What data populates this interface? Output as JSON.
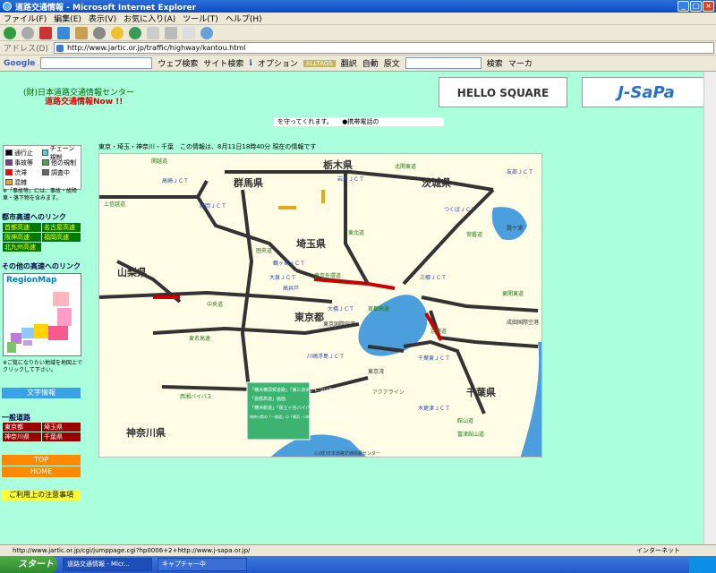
{
  "window": {
    "title": "道路交通情報 - Microsoft Internet Explorer"
  },
  "menu": [
    "ファイル(F)",
    "編集(E)",
    "表示(V)",
    "お気に入り(A)",
    "ツール(T)",
    "ヘルプ(H)"
  ],
  "address": {
    "label": "アドレス(D)",
    "url": "http://www.jartic.or.jp/traffic/highway/kantou.html"
  },
  "googlebar": {
    "brand": "Google",
    "web_search": "ウェブ検索",
    "site_search": "サイト検索",
    "options": "オプション",
    "translate": "翻訳",
    "auto": "自動",
    "original": "原文",
    "search": "検索",
    "marker": "マーカ"
  },
  "header": {
    "org": "(財)日本道路交通情報センター",
    "product": "道路交通情報Now !!",
    "banner1": "HELLO SQUARE",
    "banner2": "J-SaPa",
    "ticker": "を守ってくれます。　　●携帯電話の"
  },
  "legend": {
    "items": [
      [
        "通行止",
        "チェーン規制"
      ],
      [
        "事故等",
        "他の規制"
      ],
      [
        "渋滞",
        "調査中"
      ],
      [
        "混雑",
        ""
      ]
    ],
    "note": "※「事故等」には、事故・故障車・落下物を含みます。"
  },
  "urban": {
    "heading": "都市高速へのリンク",
    "links": [
      "首都高速",
      "名古屋高速",
      "阪神高速",
      "福岡高速",
      "北九州高速"
    ]
  },
  "other": {
    "heading": "その他の高速へのリンク",
    "region_title": "RegionMap",
    "note": "※ご覧になりたい地域を地図上でクリックして下さい。"
  },
  "buttons": {
    "text_info": "文字情報",
    "top": "TOP",
    "home": "HOME",
    "notice": "ご利用上の注意事項"
  },
  "general": {
    "heading": "一般道路",
    "links": [
      "東京都",
      "埼玉県",
      "神奈川県",
      "千葉県"
    ]
  },
  "map": {
    "caption": "東京・埼玉・神奈川・千葉　この情報は、8月11日18時40分 現在の情報です",
    "prefectures": [
      "栃木県",
      "群馬県",
      "茨城県",
      "埼玉県",
      "山梨県",
      "東京都",
      "千葉県",
      "神奈川県"
    ],
    "roads": [
      "関越道",
      "東北道",
      "北関東道",
      "常磐道",
      "東関東道",
      "中央道",
      "東名高速",
      "圏央道",
      "上信越道",
      "西湘バイパス",
      "首都高速",
      "京葉道",
      "東京外環道",
      "アクアライン",
      "富津館山道",
      "館山道"
    ],
    "jcts": [
      "高崎ＪＣＴ",
      "藤岡ＪＣＴ",
      "岩舟ＪＣＴ",
      "友部ＪＣＴ",
      "鶴ヶ島ＪＣＴ",
      "大泉ＪＣＴ",
      "三郷ＪＣＴ",
      "高井戸",
      "大橋ＪＣＴ",
      "川崎浮島ＪＣＴ",
      "千葉東ＪＣＴ",
      "木更津ＪＣＴ",
      "つくばＪＣＴ"
    ],
    "others": [
      "霞ケ浦",
      "東京国際空港",
      "成田国際空港",
      "東京湾"
    ],
    "info_box": [
      "「横浜横須賀道路」「第三京浜」について",
      "「首都高速」画面",
      "「横浜新道」「保土ヶ谷バイパス」について",
      "神奈川県の「一般道」の「横浜・川崎」画面で提供しています。"
    ],
    "copyright": "Ⓒ(財)日本道路交通情報センター"
  },
  "status": {
    "url": "http://www.jartic.or.jp/cgi/jumppage.cgi?hp0006+2+http://www.j-sapa.or.jp/",
    "zone": "インターネット"
  },
  "taskbar": {
    "start": "スタート",
    "tasks": [
      "道路交通情報 - Micr...",
      "キャプチャー中"
    ]
  },
  "colors": {
    "page_bg": "#aaffdd",
    "map_bg": "#fffde6",
    "road_normal": "#333333",
    "road_congested": "#cc0000",
    "road_crowded": "#e6a817",
    "water": "#4a9fdc",
    "closed": "#000000",
    "chain": "#66cccc",
    "accident": "#7a3b99",
    "other_reg": "#44aa44",
    "jam": "#ff0000",
    "survey": "#666666",
    "busy": "#e6a817"
  }
}
